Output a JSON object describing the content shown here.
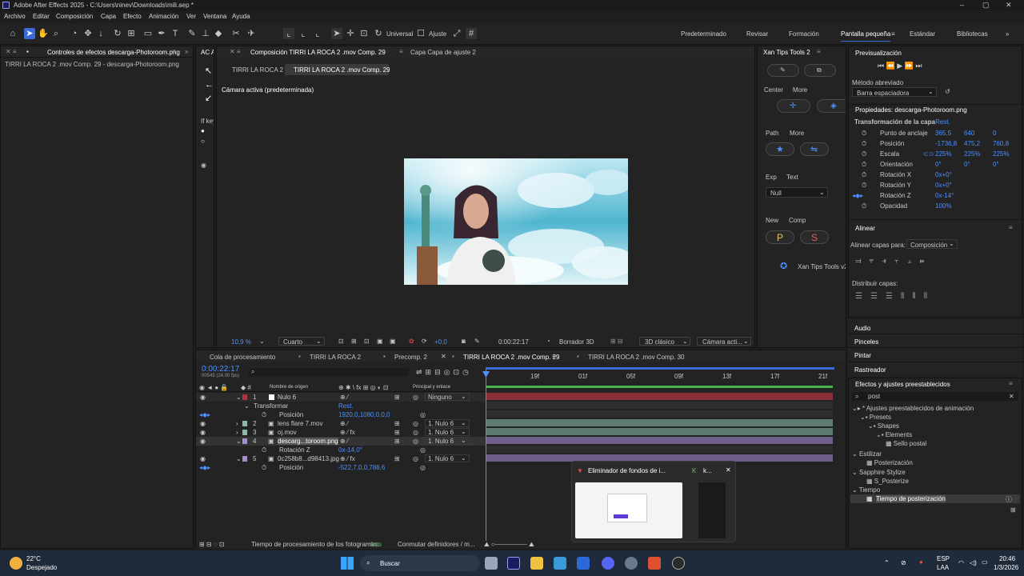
{
  "window": {
    "title": "Adobe After Effects 2025 - C:\\Users\\ninev\\Downloads\\mili.aep *"
  },
  "menu": [
    "Archivo",
    "Editar",
    "Composición",
    "Capa",
    "Efecto",
    "Animación",
    "Ver",
    "Ventana",
    "Ayuda"
  ],
  "toolbar": {
    "universal_label": "Universal",
    "ajuste_label": "Ajuste",
    "workspaces": [
      "Predeterminado",
      "Revisar",
      "Formación",
      "Pantalla pequeña",
      "Estándar",
      "Bibliotecas"
    ],
    "active_workspace": "Pantalla pequeña"
  },
  "effect_controls": {
    "tab": "Controles de efectos descarga-Photoroom.png",
    "subtitle": "TIRRI LA ROCA 2 .mov Comp. 29 - descarga-Photoroom.png"
  },
  "left_partial": {
    "tab": "AC A",
    "if_label": "If key"
  },
  "composition": {
    "tab": "Composición TIRRI LA ROCA 2 .mov Comp. 29",
    "tab2": "Capa Capa de ajuste 2",
    "breadcrumb": [
      "TIRRI LA ROCA 2",
      "TIRRI LA ROCA 2 .mov Comp. 29"
    ],
    "camera_label": "Cámara activa (predeterminada)",
    "zoom": "10,9 %",
    "resolution": "Cuarto",
    "exposure": "+0,0",
    "timecode": "0:00:22:17",
    "draft": "Borrador 3D",
    "renderer": "3D clásico",
    "camera_select": "Cámara acti..."
  },
  "xan_tips": {
    "tab": "Xan Tips Tools 2",
    "center": "Center",
    "more1": "More",
    "path": "Path",
    "more2": "More",
    "exp": "Exp",
    "text": "Text",
    "null_select": "Null",
    "new": "New",
    "comp": "Comp",
    "p_label": "P",
    "s_label": "S",
    "footer": "Xan Tips Tools v2"
  },
  "preview": {
    "title": "Previsualización",
    "method_label": "Método abreviado",
    "method_value": "Barra espaciadora"
  },
  "properties": {
    "title": "Propiedades: descarga-Photoroom.png",
    "transform_label": "Transformación de la capa",
    "reset": "Rest.",
    "rows": [
      {
        "name": "Punto de anclaje",
        "v": [
          "365,5",
          "640",
          "0"
        ]
      },
      {
        "name": "Posición",
        "v": [
          "-1736,8",
          "475,2",
          "760,8"
        ]
      },
      {
        "name": "Escala",
        "v": [
          "225%",
          "225%",
          "225%"
        ]
      },
      {
        "name": "Orientación",
        "v": [
          "0°",
          "0°",
          "0°"
        ]
      },
      {
        "name": "Rotación X",
        "v": [
          "0x+0°"
        ]
      },
      {
        "name": "Rotación Y",
        "v": [
          "0x+0°"
        ]
      },
      {
        "name": "Rotación Z",
        "v": [
          "0x-14°"
        ]
      },
      {
        "name": "Opacidad",
        "v": [
          "100%"
        ]
      }
    ]
  },
  "align": {
    "title": "Alinear",
    "align_to_label": "Alinear capas para:",
    "align_to_value": "Composición",
    "distribute_label": "Distribuir capas:"
  },
  "side_panels": [
    "Audio",
    "Pinceles",
    "Pintar",
    "Rastreador"
  ],
  "effects_presets": {
    "title": "Efectos y ajustes preestablecidos",
    "search": "post",
    "tree": [
      {
        "label": "* Ajustes preestablecidos de animación",
        "indent": 0
      },
      {
        "label": "Presets",
        "indent": 1
      },
      {
        "label": "Shapes",
        "indent": 2
      },
      {
        "label": "Elements",
        "indent": 3
      },
      {
        "label": "Sello postal",
        "indent": 4
      },
      {
        "label": "Estilizar",
        "indent": 0
      },
      {
        "label": "Posterización",
        "indent": 1
      },
      {
        "label": "Sapphire Stylize",
        "indent": 0
      },
      {
        "label": "S_Posterize",
        "indent": 1
      },
      {
        "label": "Tiempo",
        "indent": 0
      },
      {
        "label": "Tiempo de posterización",
        "indent": 1
      }
    ]
  },
  "timeline": {
    "tabs": [
      "Cola de procesamiento",
      "TIRRI LA ROCA 2",
      "Precomp. 2",
      "TIRRI LA ROCA 2 .mov Comp. 29",
      "TIRRI LA ROCA 2 .mov Comp. 30"
    ],
    "active_tab": "TIRRI LA ROCA 2 .mov Comp. 29",
    "timecode": "0:00:22:17",
    "fps": "00545 (24.00 fps)",
    "col_source": "Nombre de origen",
    "col_parent": "Principal y enlace",
    "ruler": [
      "19f",
      "01f",
      "05f",
      "09f",
      "13f",
      "17f",
      "21f"
    ],
    "layers": [
      {
        "num": "1",
        "name": "Nulo 6",
        "parent": "Ninguno",
        "color": "#b0313f",
        "kind": "layer"
      },
      {
        "num": "",
        "name": "Transformar",
        "parent": "Rest.",
        "kind": "group"
      },
      {
        "num": "",
        "name": "Posición",
        "value": "1920,0,1080,0,0,0",
        "kind": "prop"
      },
      {
        "num": "2",
        "name": "lens flare 7.mov",
        "parent": "1. Nulo 6",
        "color": "#8fb7a9",
        "kind": "layer"
      },
      {
        "num": "3",
        "name": "oj.mov",
        "parent": "1. Nulo 6",
        "color": "#8fb7a9",
        "kind": "layer"
      },
      {
        "num": "4",
        "name": "descarg...toroom.png",
        "parent": "1. Nulo 6",
        "color": "#a58fc8",
        "kind": "layer"
      },
      {
        "num": "",
        "name": "Rotación Z",
        "value": "0x-14,0°",
        "kind": "prop"
      },
      {
        "num": "5",
        "name": "0c258b8...d98413.jpg",
        "parent": "1. Nulo 6",
        "color": "#a58fc8",
        "kind": "layer"
      },
      {
        "num": "",
        "name": "Posición",
        "value": "-522,7,0,0,788,6",
        "kind": "prop"
      }
    ],
    "status_label": "Tiempo de procesamiento de los fotogramas:",
    "status_value": "4ms",
    "toggle_label": "Conmutar definidores / m..."
  },
  "popup": {
    "title": "Eliminador de fondos de i...",
    "second": "k..."
  },
  "taskbar": {
    "weather_temp": "22°C",
    "weather_desc": "Despejado",
    "search": "Buscar",
    "lang": "ESP",
    "lang2": "LAA",
    "time": "20:46",
    "date": "1/3/2026"
  },
  "colors": {
    "accent": "#3a6bd8",
    "blue_text": "#4d90fe",
    "timecode": "#4d90fe"
  }
}
